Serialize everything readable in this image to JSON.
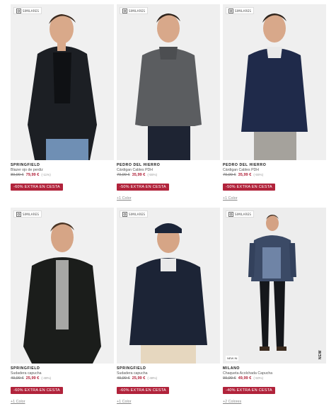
{
  "similar_label": "SIMILARES",
  "products": [
    {
      "brand": "SPRINGFIELD",
      "name": "Blazer ojo de perdiz",
      "old_price": "89,99 €",
      "new_price": "79,99 €",
      "discount": "(-11%)",
      "promo": "-60% EXTRA EN CESTA",
      "colors": "",
      "badge": "",
      "vertical": ""
    },
    {
      "brand": "PEDRO DEL HIERRO",
      "name": "Cárdigan Cables PDH",
      "old_price": "79,99 €",
      "new_price": "35,99 €",
      "discount": "(-55%)",
      "promo": "-50% EXTRA EN CESTA",
      "colors": "+1 Color",
      "badge": "",
      "vertical": ""
    },
    {
      "brand": "PEDRO DEL HIERRO",
      "name": "Cárdigan Cables PDH",
      "old_price": "79,99 €",
      "new_price": "35,99 €",
      "discount": "(-55%)",
      "promo": "-50% EXTRA EN CESTA",
      "colors": "+1 Color",
      "badge": "",
      "vertical": ""
    },
    {
      "brand": "SPRINGFIELD",
      "name": "Sudadera capucha",
      "old_price": "49,99 €",
      "new_price": "25,99 €",
      "discount": "(-48%)",
      "promo": "-60% EXTRA EN CESTA",
      "colors": "+1 Color",
      "badge": "",
      "vertical": ""
    },
    {
      "brand": "SPRINGFIELD",
      "name": "Sudadera capucha",
      "old_price": "49,99 €",
      "new_price": "25,99 €",
      "discount": "(-48%)",
      "promo": "-60% EXTRA EN CESTA",
      "colors": "+1 Color",
      "badge": "",
      "vertical": ""
    },
    {
      "brand": "MILANO",
      "name": "Chaqueta Acolchada Capucha",
      "old_price": "99,99 €",
      "new_price": "49,99 €",
      "discount": "(-50%)",
      "promo": "-40% EXTRA EN CESTA",
      "colors": "+2 Colores",
      "badge": "NEW IN",
      "vertical": "NEW"
    }
  ]
}
